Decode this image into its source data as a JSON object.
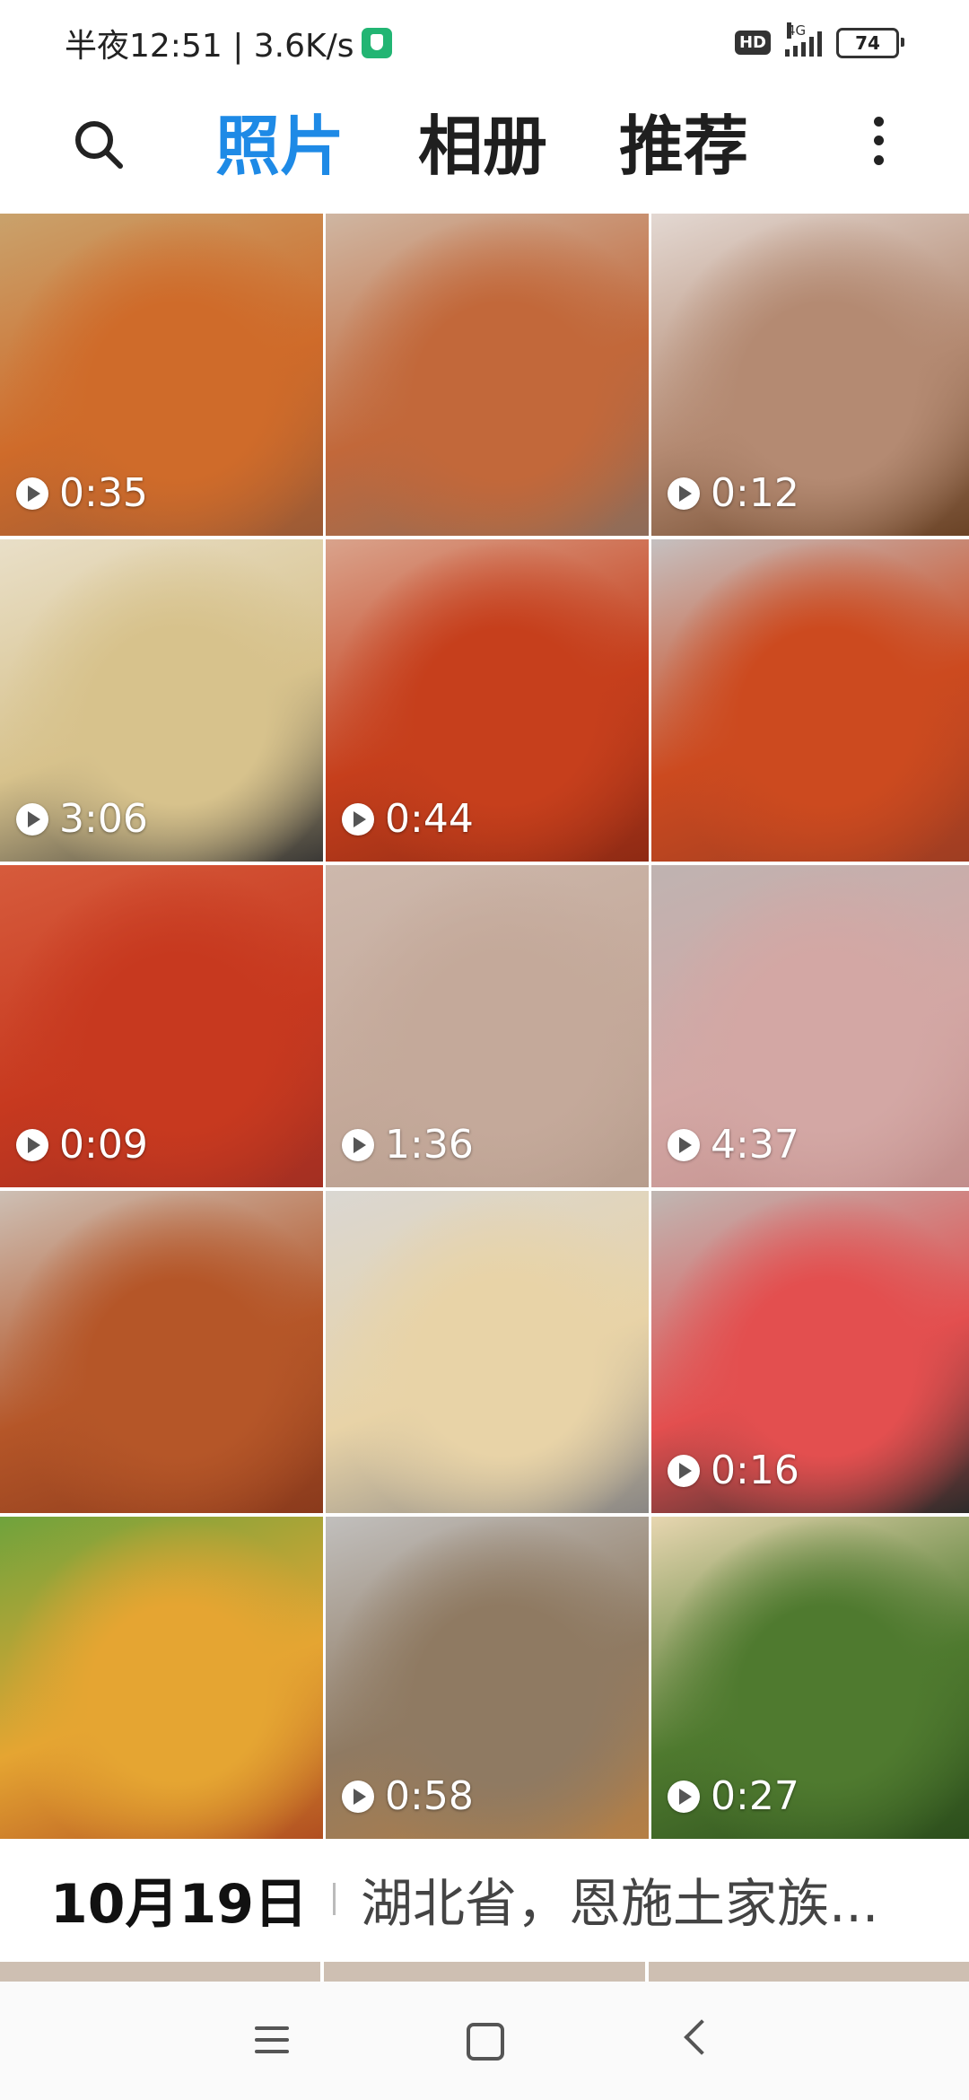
{
  "status_bar": {
    "time_speed": "半夜12:51 | 3.6K/s",
    "hd": "HD",
    "network": "4G",
    "battery": "74"
  },
  "header": {
    "tabs": [
      {
        "label": "照片",
        "active": true
      },
      {
        "label": "相册",
        "active": false
      },
      {
        "label": "推荐",
        "active": false
      }
    ],
    "accent_color": "#1e8ae6"
  },
  "grid": {
    "tiles": [
      {
        "duration": "0:35",
        "colors": [
          "#c9a26c",
          "#cf6b2a",
          "#9a5a36"
        ]
      },
      {
        "duration": "",
        "colors": [
          "#cfb6a2",
          "#c2683a",
          "#8d6c5a"
        ]
      },
      {
        "duration": "0:12",
        "colors": [
          "#e3d8d2",
          "#b48a72",
          "#6a4326"
        ]
      },
      {
        "duration": "3:06",
        "colors": [
          "#e9dfc8",
          "#d7c28c",
          "#3b3936"
        ]
      },
      {
        "duration": "0:44",
        "colors": [
          "#d9a38c",
          "#c63f1c",
          "#8e2a14"
        ]
      },
      {
        "duration": "",
        "colors": [
          "#c5c0c0",
          "#cc4a1f",
          "#9e3d22"
        ]
      },
      {
        "duration": "0:09",
        "colors": [
          "#d65b3c",
          "#c7391f",
          "#a32f22"
        ]
      },
      {
        "duration": "1:36",
        "colors": [
          "#cdb8ac",
          "#c4a99a",
          "#b79d8d"
        ]
      },
      {
        "duration": "4:37",
        "colors": [
          "#bfb3b1",
          "#d3a7a4",
          "#c28e8b"
        ]
      },
      {
        "duration": "",
        "colors": [
          "#cdbfb4",
          "#b55628",
          "#8a3a1c"
        ]
      },
      {
        "duration": "",
        "colors": [
          "#dad7d2",
          "#e8d3a7",
          "#8a8784"
        ]
      },
      {
        "duration": "0:16",
        "colors": [
          "#bfb7b3",
          "#e34f4f",
          "#2d2b2a"
        ]
      },
      {
        "duration": "",
        "colors": [
          "#6fa33c",
          "#e5a532",
          "#b14f21"
        ]
      },
      {
        "duration": "0:58",
        "colors": [
          "#c1bfbd",
          "#8f7a62",
          "#b57f45"
        ]
      },
      {
        "duration": "0:27",
        "colors": [
          "#e7d6b0",
          "#4f7a2f",
          "#2c4e1c"
        ]
      }
    ]
  },
  "section": {
    "date": "10月19日",
    "location": "湖北省，恩施土家族..."
  }
}
